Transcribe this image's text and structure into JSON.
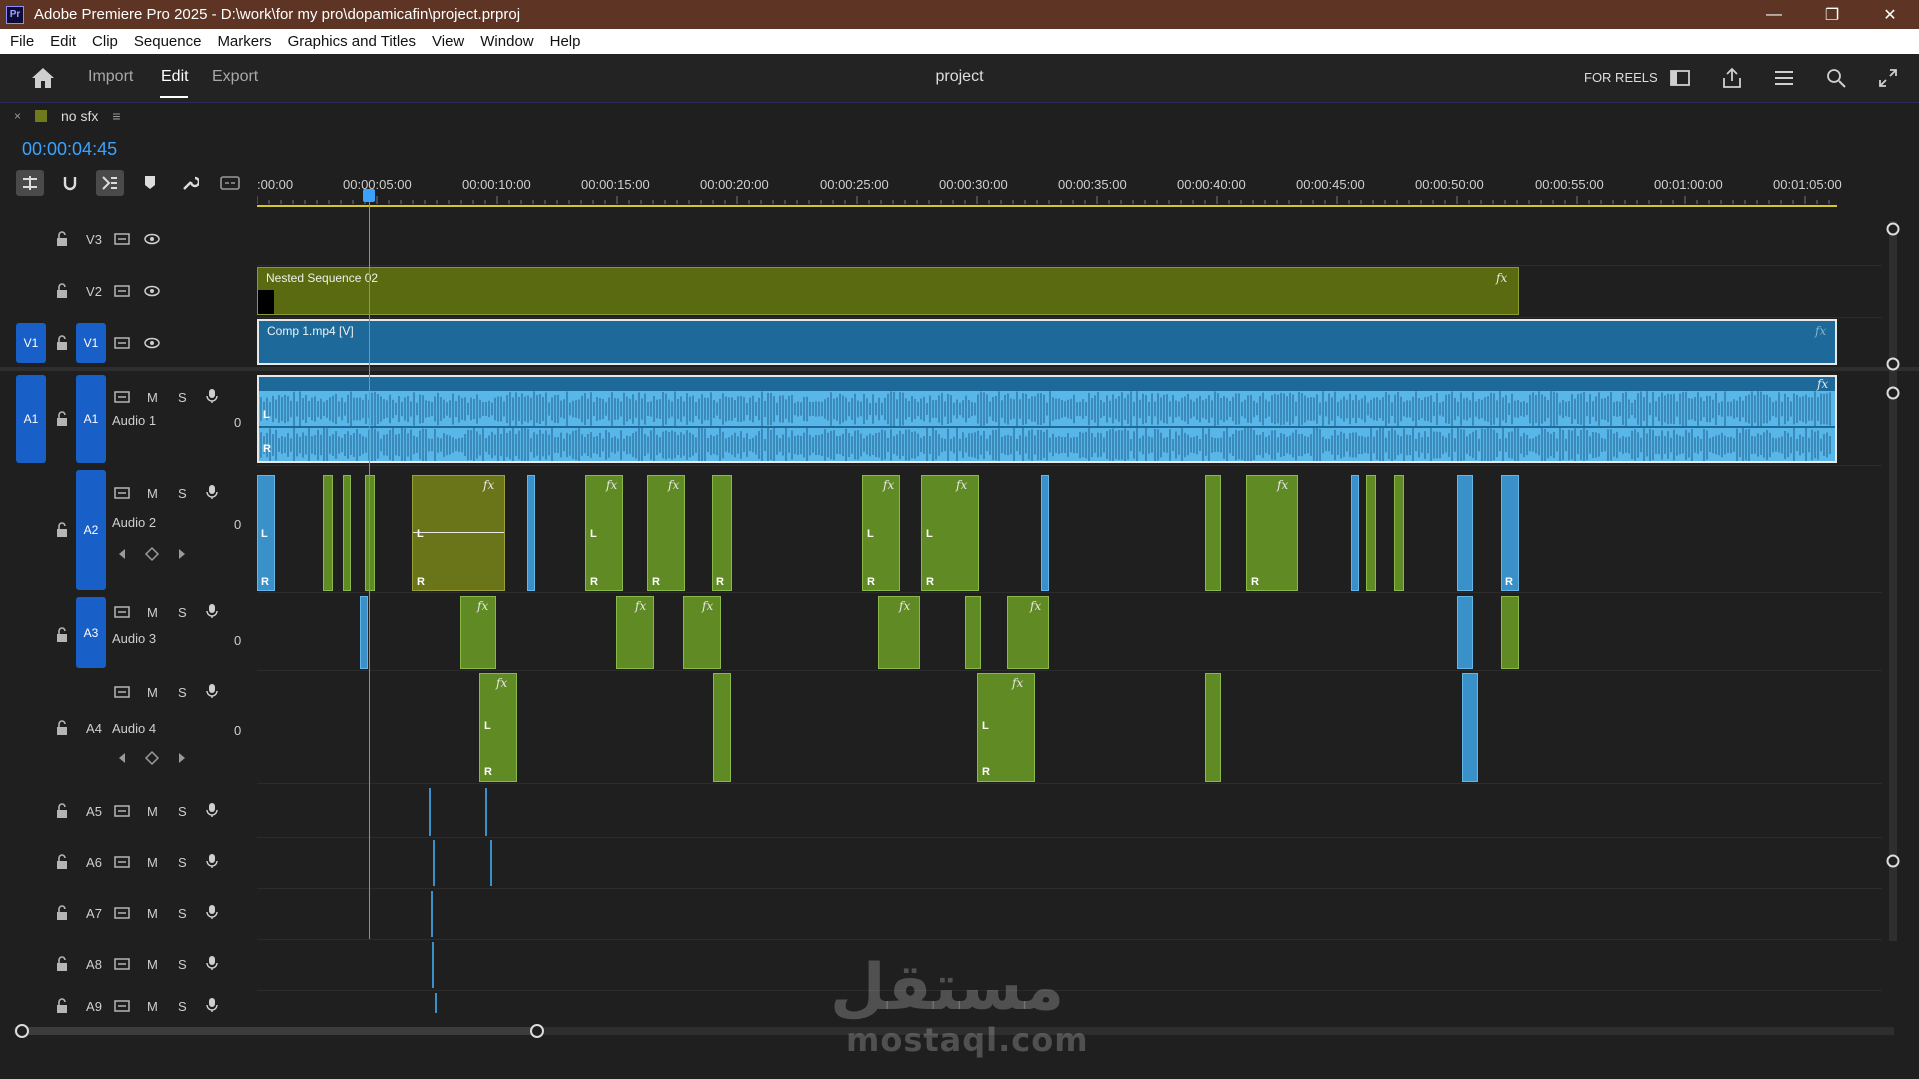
{
  "app": {
    "title": "Adobe Premiere Pro 2025 - D:\\work\\for my pro\\dopamicafin\\project.prproj",
    "logo": "Pr"
  },
  "window_controls": {
    "minimize": "—",
    "restore": "❐",
    "close": "✕"
  },
  "menu": [
    "File",
    "Edit",
    "Clip",
    "Sequence",
    "Markers",
    "Graphics and Titles",
    "View",
    "Window",
    "Help"
  ],
  "workspace": {
    "tabs": [
      "Import",
      "Edit",
      "Export"
    ],
    "active_tab": "Edit",
    "project_name": "project",
    "preset": "FOR REELS",
    "icons": [
      "panel-layout-icon",
      "share-icon",
      "quick-actions-icon",
      "search-icon",
      "fullscreen-icon"
    ]
  },
  "sequence": {
    "tab_close": "×",
    "name": "no sfx",
    "menu_glyph": "≡",
    "timecode": "00:00:04:45",
    "label_color": "#6f7a1e"
  },
  "ruler": {
    "labels": [
      ":00:00",
      "00:00:05:00",
      "00:00:10:00",
      "00:00:15:00",
      "00:00:20:00",
      "00:00:25:00",
      "00:00:30:00",
      "00:00:35:00",
      "00:00:40:00",
      "00:00:45:00",
      "00:00:50:00",
      "00:00:55:00",
      "00:01:00:00",
      "00:01:05:00"
    ]
  },
  "tracks": {
    "video": [
      {
        "id": "V3",
        "label": "V3"
      },
      {
        "id": "V2",
        "label": "V2"
      },
      {
        "id": "V1",
        "label": "V1",
        "source": "V1"
      }
    ],
    "audio": [
      {
        "id": "A1",
        "label": "A1",
        "source": "A1",
        "name": "Audio 1"
      },
      {
        "id": "A2",
        "label": "A2",
        "name": "Audio 2"
      },
      {
        "id": "A3",
        "label": "A3",
        "name": "Audio 3"
      },
      {
        "id": "A4",
        "label": "A4",
        "name": "Audio 4"
      },
      {
        "id": "A5",
        "label": "A5"
      },
      {
        "id": "A6",
        "label": "A6"
      },
      {
        "id": "A7",
        "label": "A7"
      },
      {
        "id": "A8",
        "label": "A8"
      },
      {
        "id": "A9",
        "label": "A9"
      }
    ],
    "mute_label": "M",
    "solo_label": "S",
    "volume_label": "0"
  },
  "clips": {
    "nested": "Nested Sequence 02",
    "comp": "Comp 1.mp4 [V]",
    "fx": "fx",
    "left": "L",
    "right": "R"
  },
  "colors": {
    "accent": "#3aa3ff",
    "patch": "#1860c8",
    "nested_clip": "#5a6a10",
    "video_clip": "#1d6a9a",
    "audio_clip_blue": "#4aa3d6",
    "audio_clip_green": "#5f8a24",
    "ruler_bar": "#d5c531"
  },
  "watermark": {
    "arabic": "مستقل",
    "latin": "mostaql.com"
  }
}
